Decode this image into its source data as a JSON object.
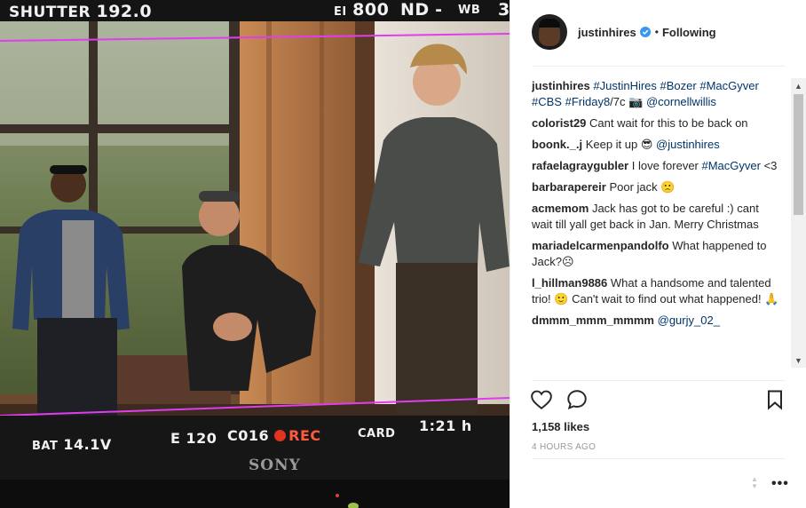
{
  "camera_hud": {
    "shutter_label": "SHUTTER",
    "shutter_value": "192.0",
    "ei_label": "EI",
    "ei_value": "800",
    "nd_label": "ND",
    "nd_value": "-",
    "wb_label": "WB",
    "wb_value": "3",
    "bat_label": "BAT",
    "bat_value": "14.1V",
    "e_code": "E 120",
    "clip": "C016",
    "rec": "REC",
    "card": "CARD",
    "remaining": "1:21 h",
    "brand": "SONY"
  },
  "post": {
    "username": "justinhires",
    "follow_status": "Following",
    "caption": {
      "user": "justinhires",
      "parts": [
        {
          "text": "#JustinHires",
          "tag": true
        },
        {
          "text": " ",
          "tag": false
        },
        {
          "text": "#Bozer",
          "tag": true
        },
        {
          "text": " ",
          "tag": false
        },
        {
          "text": "#MacGyver",
          "tag": true
        },
        {
          "text": " ",
          "tag": false
        },
        {
          "text": "#CBS",
          "tag": true
        },
        {
          "text": " ",
          "tag": false
        },
        {
          "text": "#Friday8",
          "tag": true
        },
        {
          "text": "/7c 📷 ",
          "tag": false
        },
        {
          "text": "@cornellwillis",
          "tag": true
        }
      ]
    },
    "comments": [
      {
        "user": "colorist29",
        "parts": [
          {
            "text": "Cant wait for this to be back on",
            "tag": false
          }
        ]
      },
      {
        "user": "boonk._.j",
        "parts": [
          {
            "text": "Keep it up 😎 ",
            "tag": false
          },
          {
            "text": "@justinhires",
            "tag": true
          }
        ]
      },
      {
        "user": "rafaelagraygubler",
        "parts": [
          {
            "text": "I love forever ",
            "tag": false
          },
          {
            "text": "#MacGyver",
            "tag": true
          },
          {
            "text": " <3",
            "tag": false
          }
        ]
      },
      {
        "user": "barbarapereir",
        "parts": [
          {
            "text": "Poor jack 🙁",
            "tag": false
          }
        ]
      },
      {
        "user": "acmemom",
        "parts": [
          {
            "text": "Jack has got to be careful :) cant wait till yall get back in Jan. Merry Christmas",
            "tag": false
          }
        ]
      },
      {
        "user": "mariadelcarmenpandolfo",
        "parts": [
          {
            "text": "What happened to Jack?☹",
            "tag": false
          }
        ]
      },
      {
        "user": "l_hillman9886",
        "parts": [
          {
            "text": "What a handsome and talented trio! 🙂 Can't wait to find out what happened! 🙏",
            "tag": false
          }
        ]
      },
      {
        "user": "dmmm_mmm_mmmm",
        "parts": [
          {
            "text": "@gurjy_02_",
            "tag": true
          }
        ]
      }
    ],
    "likes": "1,158 likes",
    "time_ago": "4 HOURS AGO",
    "icons": [
      "heart-icon",
      "comment-icon",
      "bookmark-icon",
      "more-options-icon",
      "verified-badge-icon"
    ],
    "colors": {
      "text": "#262626",
      "link": "#003569",
      "muted": "#999999",
      "verified": "#3897f0",
      "rec": "#e0341f"
    }
  }
}
